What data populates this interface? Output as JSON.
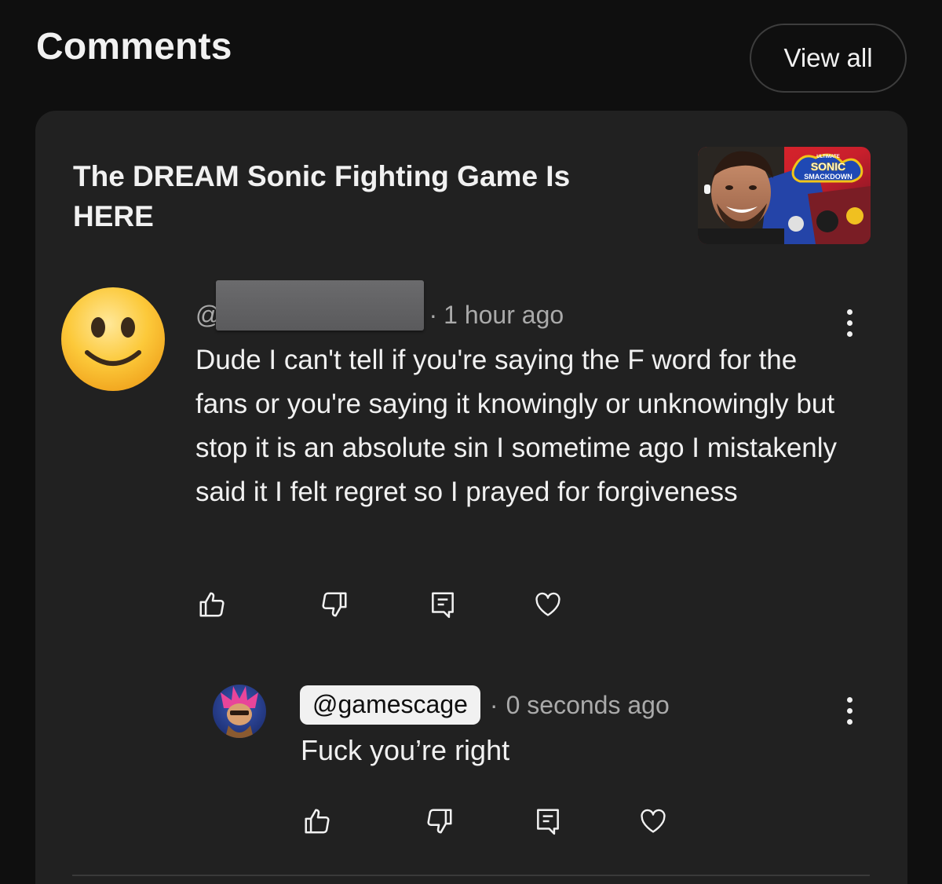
{
  "header": {
    "title": "Comments",
    "view_all_label": "View all"
  },
  "video": {
    "title": "The DREAM Sonic Fighting Game Is HERE",
    "thumbnail_text": {
      "top": "ULTIMATE",
      "logo_line1": "SONIC",
      "logo_line2": "SMACKDOWN"
    }
  },
  "comment": {
    "handle_prefix": "@",
    "time": "1 hour ago",
    "text": "Dude I can't tell if you're saying the F word for the fans or you're saying it knowingly or unknowingly but stop it is an absolute sin I sometime ago I mistakenly said it I felt regret so I prayed for forgiveness",
    "actions": [
      "like-icon",
      "dislike-icon",
      "reply-icon",
      "heart-icon"
    ]
  },
  "reply": {
    "handle": "@gamescage",
    "separator": "·",
    "time": "0 seconds ago",
    "text": "Fuck you’re right",
    "actions": [
      "like-icon",
      "dislike-icon",
      "reply-icon",
      "heart-icon"
    ]
  },
  "colors": {
    "background": "#0f0f0f",
    "card": "#212121",
    "text_primary": "#f1f1f1",
    "text_secondary": "#aaaaaa"
  }
}
